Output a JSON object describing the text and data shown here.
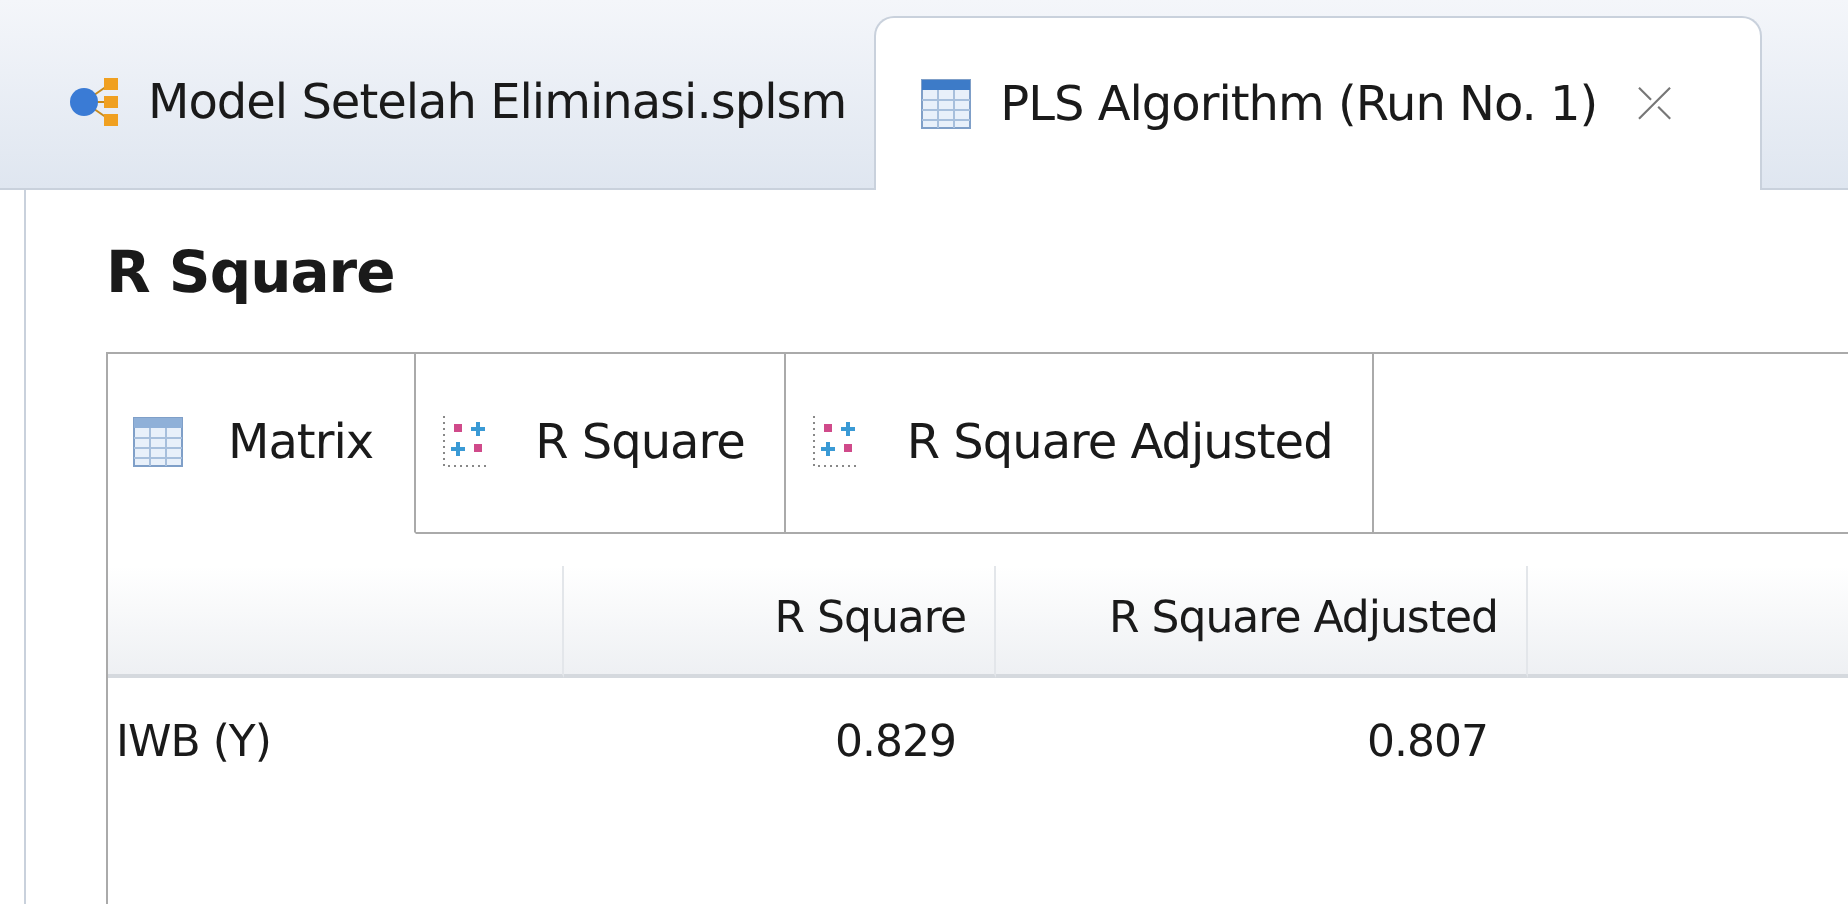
{
  "editor_tabs": [
    {
      "label": "Model Setelah Eliminasi.splsm",
      "kind": "model",
      "selected": false
    },
    {
      "label": "PLS Algorithm (Run No. 1)",
      "kind": "table",
      "selected": true,
      "close": "⤫"
    }
  ],
  "section_title": "R Square",
  "view_tabs": [
    {
      "label": "Matrix",
      "kind": "matrix",
      "selected": true
    },
    {
      "label": "R Square",
      "kind": "chart",
      "selected": false
    },
    {
      "label": "R Square Adjusted",
      "kind": "chart",
      "selected": false
    }
  ],
  "table": {
    "columns": [
      "R Square",
      "R Square Adjusted"
    ],
    "rows": [
      {
        "label": "IWB (Y)",
        "cells": [
          "0.829",
          "0.807"
        ]
      }
    ]
  }
}
